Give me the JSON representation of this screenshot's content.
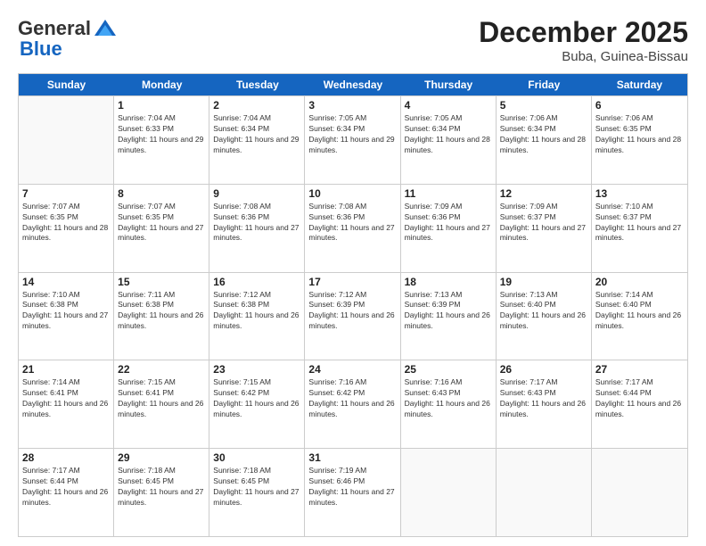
{
  "logo": {
    "general": "General",
    "blue": "Blue"
  },
  "title": "December 2025",
  "subtitle": "Buba, Guinea-Bissau",
  "header_days": [
    "Sunday",
    "Monday",
    "Tuesday",
    "Wednesday",
    "Thursday",
    "Friday",
    "Saturday"
  ],
  "weeks": [
    [
      {
        "day": "",
        "sunrise": "",
        "sunset": "",
        "daylight": ""
      },
      {
        "day": "1",
        "sunrise": "Sunrise: 7:04 AM",
        "sunset": "Sunset: 6:33 PM",
        "daylight": "Daylight: 11 hours and 29 minutes."
      },
      {
        "day": "2",
        "sunrise": "Sunrise: 7:04 AM",
        "sunset": "Sunset: 6:34 PM",
        "daylight": "Daylight: 11 hours and 29 minutes."
      },
      {
        "day": "3",
        "sunrise": "Sunrise: 7:05 AM",
        "sunset": "Sunset: 6:34 PM",
        "daylight": "Daylight: 11 hours and 29 minutes."
      },
      {
        "day": "4",
        "sunrise": "Sunrise: 7:05 AM",
        "sunset": "Sunset: 6:34 PM",
        "daylight": "Daylight: 11 hours and 28 minutes."
      },
      {
        "day": "5",
        "sunrise": "Sunrise: 7:06 AM",
        "sunset": "Sunset: 6:34 PM",
        "daylight": "Daylight: 11 hours and 28 minutes."
      },
      {
        "day": "6",
        "sunrise": "Sunrise: 7:06 AM",
        "sunset": "Sunset: 6:35 PM",
        "daylight": "Daylight: 11 hours and 28 minutes."
      }
    ],
    [
      {
        "day": "7",
        "sunrise": "Sunrise: 7:07 AM",
        "sunset": "Sunset: 6:35 PM",
        "daylight": "Daylight: 11 hours and 28 minutes."
      },
      {
        "day": "8",
        "sunrise": "Sunrise: 7:07 AM",
        "sunset": "Sunset: 6:35 PM",
        "daylight": "Daylight: 11 hours and 27 minutes."
      },
      {
        "day": "9",
        "sunrise": "Sunrise: 7:08 AM",
        "sunset": "Sunset: 6:36 PM",
        "daylight": "Daylight: 11 hours and 27 minutes."
      },
      {
        "day": "10",
        "sunrise": "Sunrise: 7:08 AM",
        "sunset": "Sunset: 6:36 PM",
        "daylight": "Daylight: 11 hours and 27 minutes."
      },
      {
        "day": "11",
        "sunrise": "Sunrise: 7:09 AM",
        "sunset": "Sunset: 6:36 PM",
        "daylight": "Daylight: 11 hours and 27 minutes."
      },
      {
        "day": "12",
        "sunrise": "Sunrise: 7:09 AM",
        "sunset": "Sunset: 6:37 PM",
        "daylight": "Daylight: 11 hours and 27 minutes."
      },
      {
        "day": "13",
        "sunrise": "Sunrise: 7:10 AM",
        "sunset": "Sunset: 6:37 PM",
        "daylight": "Daylight: 11 hours and 27 minutes."
      }
    ],
    [
      {
        "day": "14",
        "sunrise": "Sunrise: 7:10 AM",
        "sunset": "Sunset: 6:38 PM",
        "daylight": "Daylight: 11 hours and 27 minutes."
      },
      {
        "day": "15",
        "sunrise": "Sunrise: 7:11 AM",
        "sunset": "Sunset: 6:38 PM",
        "daylight": "Daylight: 11 hours and 26 minutes."
      },
      {
        "day": "16",
        "sunrise": "Sunrise: 7:12 AM",
        "sunset": "Sunset: 6:38 PM",
        "daylight": "Daylight: 11 hours and 26 minutes."
      },
      {
        "day": "17",
        "sunrise": "Sunrise: 7:12 AM",
        "sunset": "Sunset: 6:39 PM",
        "daylight": "Daylight: 11 hours and 26 minutes."
      },
      {
        "day": "18",
        "sunrise": "Sunrise: 7:13 AM",
        "sunset": "Sunset: 6:39 PM",
        "daylight": "Daylight: 11 hours and 26 minutes."
      },
      {
        "day": "19",
        "sunrise": "Sunrise: 7:13 AM",
        "sunset": "Sunset: 6:40 PM",
        "daylight": "Daylight: 11 hours and 26 minutes."
      },
      {
        "day": "20",
        "sunrise": "Sunrise: 7:14 AM",
        "sunset": "Sunset: 6:40 PM",
        "daylight": "Daylight: 11 hours and 26 minutes."
      }
    ],
    [
      {
        "day": "21",
        "sunrise": "Sunrise: 7:14 AM",
        "sunset": "Sunset: 6:41 PM",
        "daylight": "Daylight: 11 hours and 26 minutes."
      },
      {
        "day": "22",
        "sunrise": "Sunrise: 7:15 AM",
        "sunset": "Sunset: 6:41 PM",
        "daylight": "Daylight: 11 hours and 26 minutes."
      },
      {
        "day": "23",
        "sunrise": "Sunrise: 7:15 AM",
        "sunset": "Sunset: 6:42 PM",
        "daylight": "Daylight: 11 hours and 26 minutes."
      },
      {
        "day": "24",
        "sunrise": "Sunrise: 7:16 AM",
        "sunset": "Sunset: 6:42 PM",
        "daylight": "Daylight: 11 hours and 26 minutes."
      },
      {
        "day": "25",
        "sunrise": "Sunrise: 7:16 AM",
        "sunset": "Sunset: 6:43 PM",
        "daylight": "Daylight: 11 hours and 26 minutes."
      },
      {
        "day": "26",
        "sunrise": "Sunrise: 7:17 AM",
        "sunset": "Sunset: 6:43 PM",
        "daylight": "Daylight: 11 hours and 26 minutes."
      },
      {
        "day": "27",
        "sunrise": "Sunrise: 7:17 AM",
        "sunset": "Sunset: 6:44 PM",
        "daylight": "Daylight: 11 hours and 26 minutes."
      }
    ],
    [
      {
        "day": "28",
        "sunrise": "Sunrise: 7:17 AM",
        "sunset": "Sunset: 6:44 PM",
        "daylight": "Daylight: 11 hours and 26 minutes."
      },
      {
        "day": "29",
        "sunrise": "Sunrise: 7:18 AM",
        "sunset": "Sunset: 6:45 PM",
        "daylight": "Daylight: 11 hours and 27 minutes."
      },
      {
        "day": "30",
        "sunrise": "Sunrise: 7:18 AM",
        "sunset": "Sunset: 6:45 PM",
        "daylight": "Daylight: 11 hours and 27 minutes."
      },
      {
        "day": "31",
        "sunrise": "Sunrise: 7:19 AM",
        "sunset": "Sunset: 6:46 PM",
        "daylight": "Daylight: 11 hours and 27 minutes."
      },
      {
        "day": "",
        "sunrise": "",
        "sunset": "",
        "daylight": ""
      },
      {
        "day": "",
        "sunrise": "",
        "sunset": "",
        "daylight": ""
      },
      {
        "day": "",
        "sunrise": "",
        "sunset": "",
        "daylight": ""
      }
    ]
  ]
}
